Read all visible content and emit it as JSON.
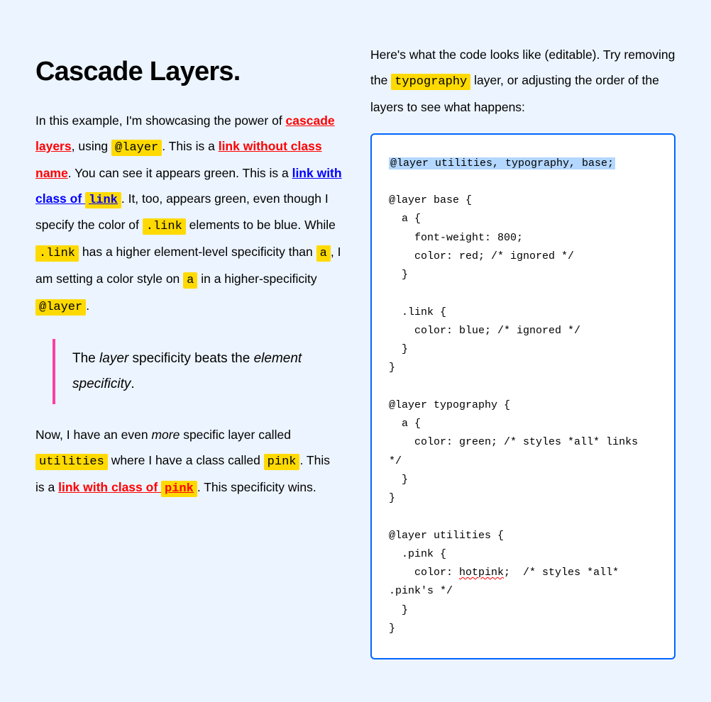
{
  "heading": "Cascade Layers.",
  "p1": {
    "t1": "In this example, I'm showcasing the power of ",
    "link_cascade_layers": "cascade layers",
    "t2": ", using ",
    "code_layer": "@layer",
    "t3": ". This is a ",
    "link_without_class": "link without class name",
    "t4": ". You can see it appears green. This is a ",
    "link_with_class_link_text": "link with class of ",
    "link_code_link": "link",
    "t5": ". It, too, appears green, even though I specify the color of ",
    "code_dotlink1": ".link",
    "t6": " elements to be blue. While ",
    "code_dotlink2": ".link",
    "t7": " has a higher element-level specificity than ",
    "code_a1": "a",
    "t8": ", I am setting a color style on ",
    "code_a2": "a",
    "t9": " in a higher-specificity ",
    "code_layer2": "@layer",
    "t10": "."
  },
  "blockquote": {
    "t1": "The ",
    "em1": "layer",
    "t2": " specificity beats the ",
    "em2": "element specificity",
    "t3": "."
  },
  "p2": {
    "t1": "Now, I have an even ",
    "em_more": "more",
    "t2": " specific layer called ",
    "code_utilities": "utilities",
    "t3": " where I have a class called ",
    "code_pink": "pink",
    "t4": ". This is a ",
    "link_with_class_pink_text": "link with class of ",
    "link_code_pink": "pink",
    "t5": ". This specificity wins."
  },
  "right_p": {
    "t1": "Here's what the code looks like (editable). Try removing the ",
    "code_typography": "typography",
    "t2": " layer, or adjusting the order of the layers to see what happens:"
  },
  "code": {
    "line1": "@layer utilities, typography, base;",
    "block_base_open": "@layer base {",
    "a_open": "  a {",
    "a_fw": "    font-weight: 800;",
    "a_color": "    color: red; /* ignored */",
    "close1": "  }",
    "blank": "",
    "link_open": "  .link {",
    "link_color": "    color: blue; /* ignored */",
    "close2": "  }",
    "block_close1": "}",
    "block_typo_open": "@layer typography {",
    "typo_a_open": "  a {",
    "typo_a_color": "    color: green; /* styles *all* links */",
    "close3": "  }",
    "block_close2": "}",
    "block_util_open": "@layer utilities {",
    "util_pink_open": "  .pink {",
    "util_pink_color_pre": "    color: ",
    "util_pink_hotpink": "hotpink",
    "util_pink_color_post": ";  /* styles *all* .pink's */",
    "close4": "  }",
    "block_close3": "}"
  }
}
